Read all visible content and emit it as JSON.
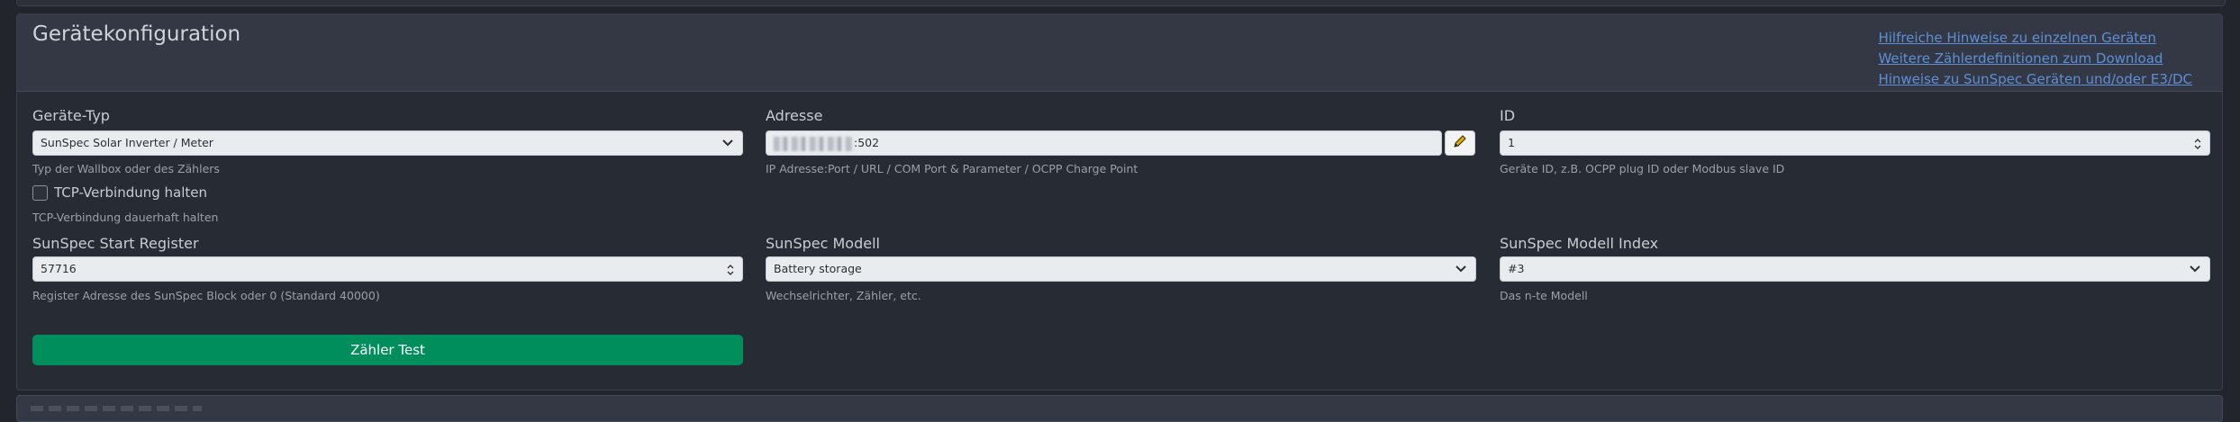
{
  "card": {
    "title": "Gerätekonfiguration",
    "help_links": [
      "Hilfreiche Hinweise zu einzelnen Geräten",
      "Weitere Zählerdefinitionen zum Download",
      "Hinweise zu SunSpec Geräten und/oder E3/DC"
    ]
  },
  "device_type": {
    "label": "Geräte-Typ",
    "value": "SunSpec Solar Inverter / Meter",
    "hint": "Typ der Wallbox oder des Zählers"
  },
  "address": {
    "label": "Adresse",
    "value_visible": ":502",
    "hint": "IP Adresse:Port / URL / COM Port & Parameter / OCPP Charge Point"
  },
  "id": {
    "label": "ID",
    "value": "1",
    "hint": "Geräte ID, z.B. OCPP plug ID oder Modbus slave ID"
  },
  "tcp": {
    "label": "TCP-Verbindung halten",
    "hint": "TCP-Verbindung dauerhaft halten",
    "checked": false
  },
  "sunspec_start": {
    "label": "SunSpec Start Register",
    "value": "57716",
    "hint": "Register Adresse des SunSpec Block oder 0 (Standard 40000)"
  },
  "sunspec_model": {
    "label": "SunSpec Modell",
    "value": "Battery storage",
    "hint": "Wechselrichter, Zähler, etc."
  },
  "sunspec_index": {
    "label": "SunSpec Modell Index",
    "value": "#3",
    "hint": "Das n-te Modell"
  },
  "test_button": {
    "label": "Zähler Test"
  },
  "colors": {
    "background": "#22252c",
    "card_header": "#333844",
    "link": "#5d8fd6",
    "button": "#008f5c"
  },
  "icons": {
    "select": "chevron-down-icon",
    "number": "spinner-icon",
    "edit": "pencil-icon"
  }
}
